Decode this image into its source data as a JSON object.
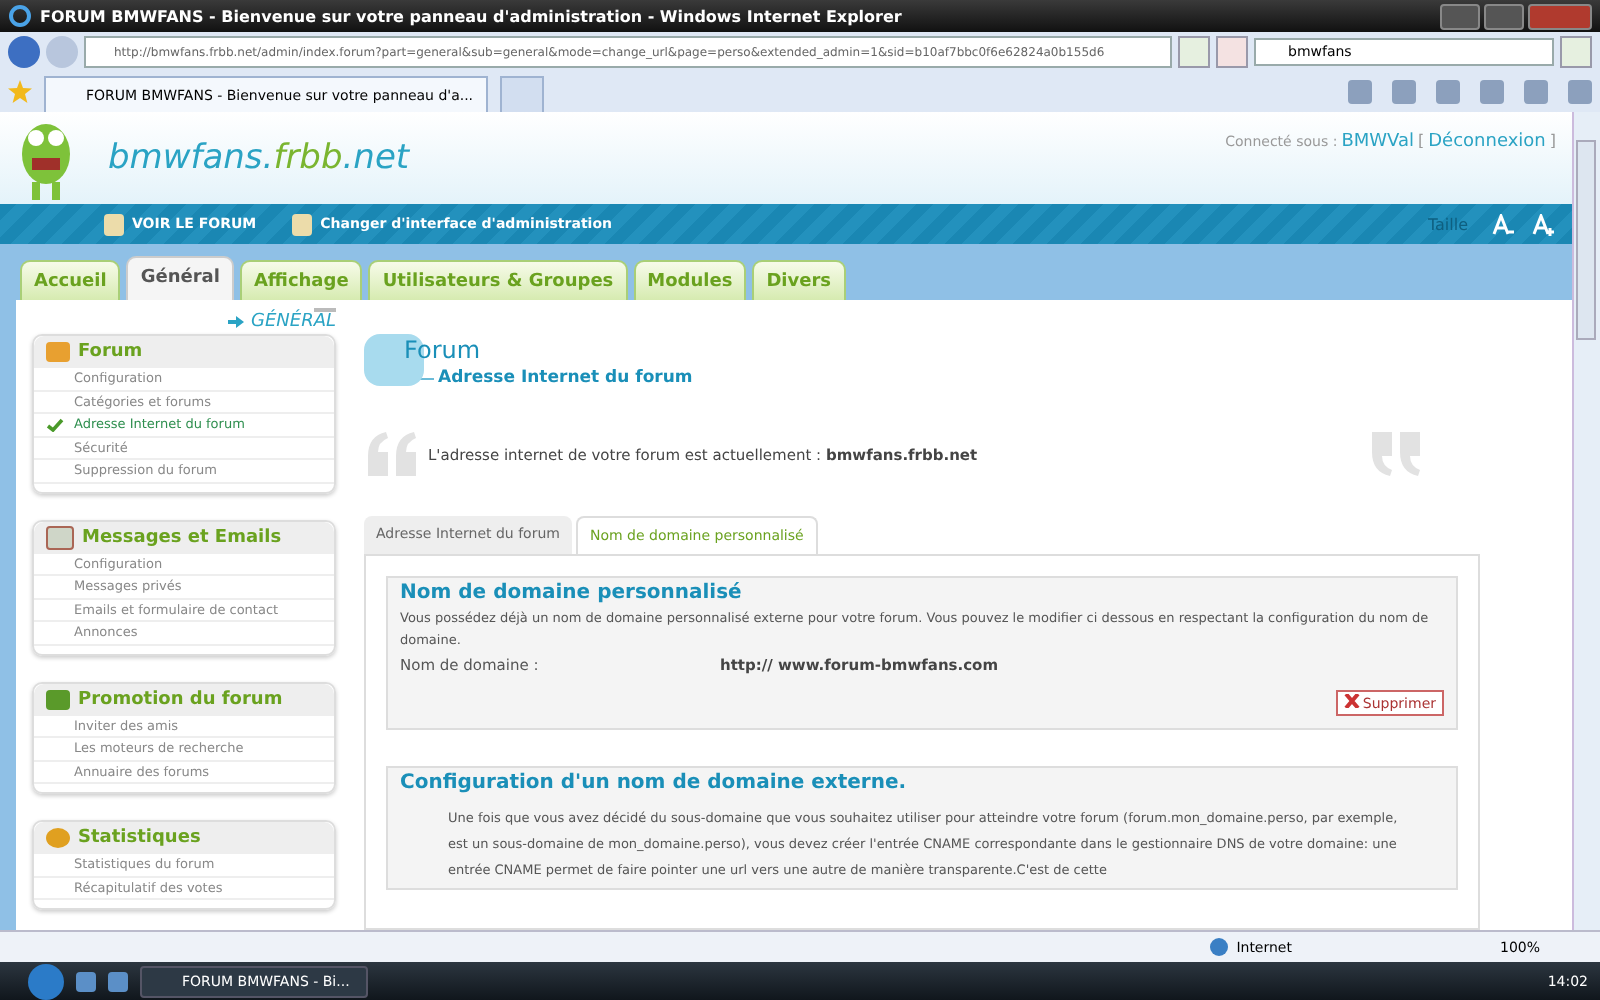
{
  "window": {
    "title": "FORUM BMWFANS - Bienvenue sur votre panneau d'administration - Windows Internet Explorer"
  },
  "browser": {
    "address": "http://bmwfans.frbb.net/admin/index.forum?part=general&sub=general&mode=change_url&page=perso&extended_admin=1&sid=b10af7bbc0f6e62824a0b155d6",
    "search_value": "bmwfans",
    "tab_title": "FORUM BMWFANS - Bienvenue sur votre panneau d'a..."
  },
  "header": {
    "logo_parts": [
      "bmwfans.",
      "frbb",
      ".net"
    ],
    "connected_label": "Connecté sous :",
    "user": "BMWVal",
    "open_bracket": "[",
    "logout": "Déconnexion",
    "close_bracket": "]"
  },
  "nav": {
    "items": [
      "VOIR LE FORUM",
      "Changer d'interface d'administration"
    ],
    "size_label": "Taille"
  },
  "main_tabs": [
    {
      "label": "Accueil",
      "selected": false
    },
    {
      "label": "Général",
      "selected": true
    },
    {
      "label": "Affichage",
      "selected": false
    },
    {
      "label": "Utilisateurs & Groupes",
      "selected": false
    },
    {
      "label": "Modules",
      "selected": false
    },
    {
      "label": "Divers",
      "selected": false
    }
  ],
  "sidebar": {
    "section_label": "GÉNÉRAL",
    "sections": [
      {
        "title": "Forum",
        "items": [
          {
            "label": "Configuration",
            "selected": false
          },
          {
            "label": "Catégories et forums",
            "selected": false
          },
          {
            "label": "Adresse Internet du forum",
            "selected": true
          },
          {
            "label": "Sécurité",
            "selected": false
          },
          {
            "label": "Suppression du forum",
            "selected": false
          }
        ]
      },
      {
        "title": "Messages et Emails",
        "items": [
          {
            "label": "Configuration",
            "selected": false
          },
          {
            "label": "Messages privés",
            "selected": false
          },
          {
            "label": "Emails et formulaire de contact",
            "selected": false
          },
          {
            "label": "Annonces",
            "selected": false
          }
        ]
      },
      {
        "title": "Promotion du forum",
        "items": [
          {
            "label": "Inviter des amis",
            "selected": false
          },
          {
            "label": "Les moteurs de recherche",
            "selected": false
          },
          {
            "label": "Annuaire des forums",
            "selected": false
          }
        ]
      },
      {
        "title": "Statistiques",
        "items": [
          {
            "label": "Statistiques du forum",
            "selected": false
          },
          {
            "label": "Récapitulatif des votes",
            "selected": false
          }
        ]
      }
    ]
  },
  "content": {
    "heading": "Forum",
    "subheading": "Adresse Internet du forum",
    "quote": "L'adresse internet de votre forum est actuellement : **bmwfans.frbb.net**",
    "sub_tabs": [
      {
        "label": "Adresse Internet du forum",
        "selected": false
      },
      {
        "label": "Nom de domaine personnalisé",
        "selected": true
      }
    ],
    "custom_domain": {
      "legend": "Nom de domaine personnalisé",
      "text": "Vous possédez déjà un nom de domaine personnalisé externe pour votre forum. Vous pouvez le modifier ci dessous en respectant la configuration du nom de domaine.",
      "field_label": "Nom de domaine :",
      "field_value": "http:// www.forum-bmwfans.com",
      "delete_button": "Supprimer"
    },
    "external": {
      "legend": "Configuration d'un nom de domaine externe.",
      "text": "Une fois que vous avez décidé du sous-domaine que vous souhaitez utiliser pour atteindre votre forum (forum.mon_domaine.perso, par exemple, est un sous-domaine de mon_domaine.perso), vous devez créer l'entrée CNAME correspondante dans le gestionnaire DNS de votre domaine: une entrée CNAME permet de faire pointer une url vers une autre de manière transparente.C'est de cette"
    }
  },
  "status_bar": {
    "zone": "Internet",
    "zoom": "100%"
  },
  "taskbar": {
    "window_button": "FORUM BMWFANS - Bi...",
    "clock": "14:02"
  }
}
